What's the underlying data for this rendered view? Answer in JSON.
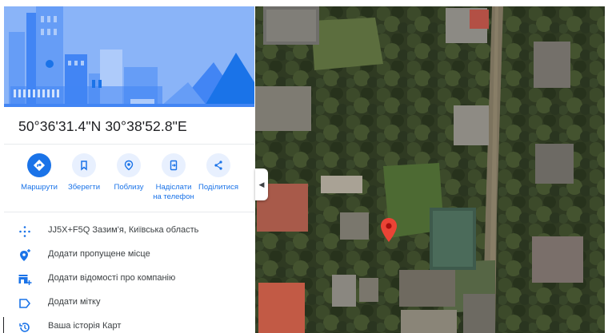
{
  "place": {
    "coordinates": "50°36'31.4\"N 30°38'52.8\"E"
  },
  "actions": [
    {
      "label": "Маршрути",
      "icon": "directions-icon"
    },
    {
      "label": "Зберегти",
      "icon": "bookmark-icon"
    },
    {
      "label": "Поблизу",
      "icon": "nearby-icon"
    },
    {
      "label": "Надіслати\nна телефон",
      "icon": "send-to-phone-icon"
    },
    {
      "label": "Поділитися",
      "icon": "share-icon"
    }
  ],
  "list": [
    {
      "text": "JJ5X+F5Q Зазим'я, Київська область",
      "icon": "plus-code-icon"
    },
    {
      "text": "Додати пропущене місце",
      "icon": "add-place-icon"
    },
    {
      "text": "Додати відомості про компанію",
      "icon": "add-business-icon"
    },
    {
      "text": "Додати мітку",
      "icon": "label-icon"
    },
    {
      "text": "Ваша історія Карт",
      "icon": "history-icon"
    }
  ],
  "colors": {
    "accent": "#1a73e8",
    "hero_bg": "#8ab4f8",
    "pin": "#ea4335"
  }
}
